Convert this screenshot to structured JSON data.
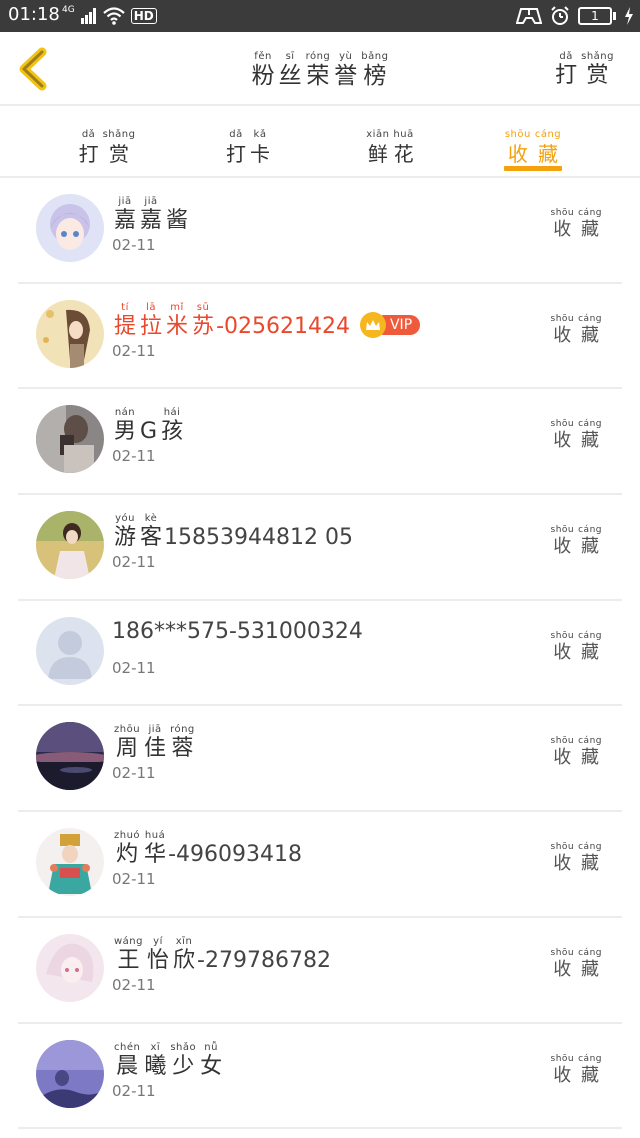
{
  "status_bar": {
    "time": "01:18",
    "network": "4G",
    "hd": "HD",
    "battery": "1"
  },
  "header": {
    "title": [
      {
        "py": "fěn",
        "hz": "粉"
      },
      {
        "py": "sī",
        "hz": "丝"
      },
      {
        "py": "róng",
        "hz": "荣"
      },
      {
        "py": "yù",
        "hz": "誉"
      },
      {
        "py": "bǎng",
        "hz": "榜"
      }
    ],
    "right_action": [
      {
        "py": "dǎ",
        "hz": "打"
      },
      {
        "py": "shǎng",
        "hz": "赏"
      }
    ]
  },
  "tabs": [
    {
      "label": [
        {
          "py": "dǎ",
          "hz": "打"
        },
        {
          "py": "shǎng",
          "hz": "赏"
        }
      ],
      "active": false
    },
    {
      "label": [
        {
          "py": "dǎ",
          "hz": "打"
        },
        {
          "py": "kǎ",
          "hz": "卡"
        }
      ],
      "active": false
    },
    {
      "label": [
        {
          "py": "xiān",
          "hz": "鲜"
        },
        {
          "py": "huā",
          "hz": "花"
        }
      ],
      "active": false
    },
    {
      "label": [
        {
          "py": "shōu",
          "hz": "收"
        },
        {
          "py": "cáng",
          "hz": "藏"
        }
      ],
      "active": true
    }
  ],
  "colors": {
    "accent": "#f3a20d",
    "vip_name": "#e9482c",
    "status_bar": "#3b3b3b"
  },
  "row_action": [
    {
      "py": "shōu",
      "hz": "收"
    },
    {
      "py": "cáng",
      "hz": "藏"
    }
  ],
  "fans": [
    {
      "name": [
        {
          "py": "jiā",
          "hz": "嘉"
        },
        {
          "py": "jiā",
          "hz": "嘉"
        },
        {
          "py": "",
          "hz": "酱"
        }
      ],
      "suffix": "",
      "date": "02-11",
      "vip": false,
      "avatar": "anime-girl"
    },
    {
      "name": [
        {
          "py": "tí",
          "hz": "提"
        },
        {
          "py": "lā",
          "hz": "拉"
        },
        {
          "py": "mǐ",
          "hz": "米"
        },
        {
          "py": "sū",
          "hz": "苏"
        }
      ],
      "suffix": "-025621424",
      "date": "02-11",
      "vip": true,
      "vip_label": "VIP",
      "avatar": "girl-umbrella"
    },
    {
      "name": [
        {
          "py": "nán",
          "hz": "男"
        },
        {
          "py": "",
          "hz": "G"
        },
        {
          "py": "hái",
          "hz": "孩"
        }
      ],
      "suffix": "",
      "date": "02-11",
      "vip": false,
      "avatar": "boy-photo"
    },
    {
      "name": [
        {
          "py": "yóu",
          "hz": "游"
        },
        {
          "py": "kè",
          "hz": "客"
        }
      ],
      "suffix": "15853944812 05",
      "date": "02-11",
      "vip": false,
      "avatar": "girl-field"
    },
    {
      "name": [],
      "suffix": "186***575-531000324",
      "date": "02-11",
      "vip": false,
      "avatar": "default-user"
    },
    {
      "name": [
        {
          "py": "zhōu",
          "hz": "周"
        },
        {
          "py": "jiā",
          "hz": "佳"
        },
        {
          "py": "róng",
          "hz": "蓉"
        }
      ],
      "suffix": "",
      "date": "02-11",
      "vip": false,
      "avatar": "night-sky"
    },
    {
      "name": [
        {
          "py": "zhuó",
          "hz": "灼"
        },
        {
          "py": "huá",
          "hz": "华"
        }
      ],
      "suffix": "-496093418",
      "date": "02-11",
      "vip": false,
      "avatar": "costume"
    },
    {
      "name": [
        {
          "py": "wáng",
          "hz": "王"
        },
        {
          "py": "yí",
          "hz": "怡"
        },
        {
          "py": "xīn",
          "hz": "欣"
        }
      ],
      "suffix": "-279786782",
      "date": "02-11",
      "vip": false,
      "avatar": "anime-pink"
    },
    {
      "name": [
        {
          "py": "chén",
          "hz": "晨"
        },
        {
          "py": "xī",
          "hz": "曦"
        },
        {
          "py": "shǎo",
          "hz": "少"
        },
        {
          "py": "nǚ",
          "hz": "女"
        }
      ],
      "suffix": "",
      "date": "02-11",
      "vip": false,
      "avatar": "purple-sky"
    }
  ]
}
